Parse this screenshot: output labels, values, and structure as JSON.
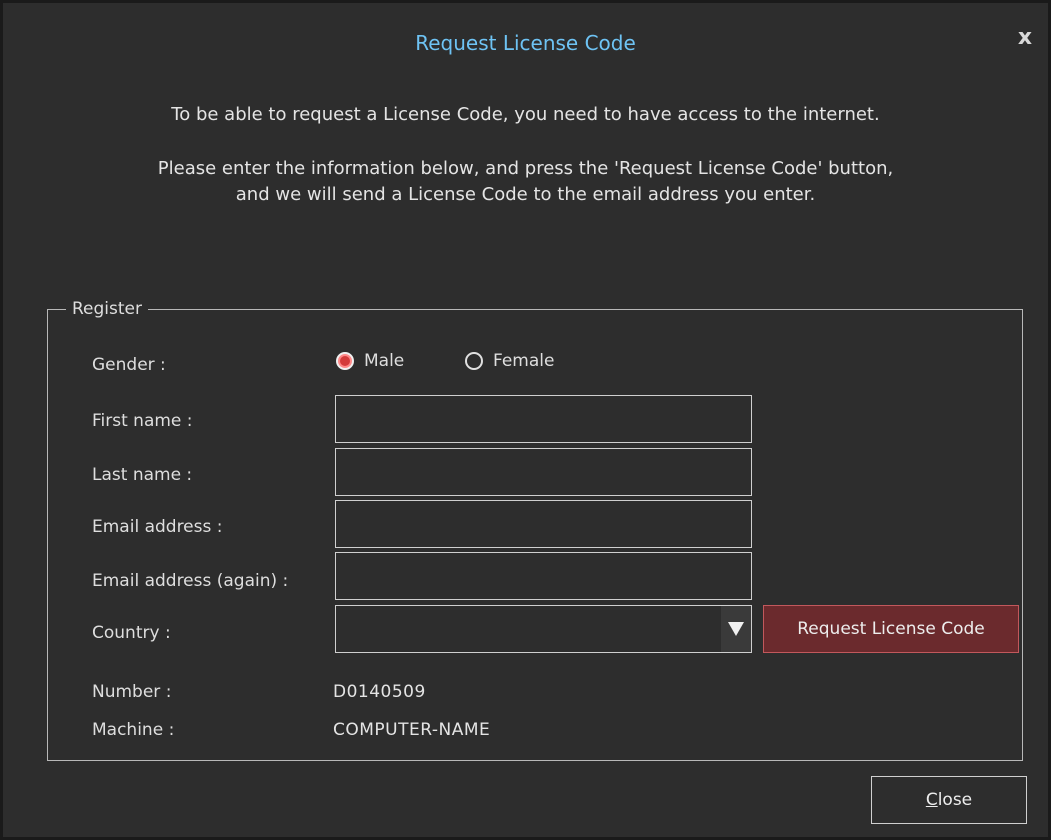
{
  "dialog": {
    "title": "Request License Code",
    "close_glyph": "x",
    "intro_line1": "To be able to request a License Code, you need to have access to the internet.",
    "intro_line2": "Please enter the information below, and press the 'Request License Code' button,",
    "intro_line3": "and we will send a License Code to the email address you enter.",
    "accent_color": "#6ec3f4"
  },
  "register": {
    "legend": "Register",
    "gender_label": "Gender :",
    "gender_options": [
      {
        "label": "Male",
        "selected": true
      },
      {
        "label": "Female",
        "selected": false
      }
    ],
    "first_name_label": "First name :",
    "first_name_value": "",
    "last_name_label": "Last name :",
    "last_name_value": "",
    "email_label": "Email address :",
    "email_value": "",
    "email_again_label": "Email address (again) :",
    "email_again_value": "",
    "country_label": "Country :",
    "country_value": "",
    "country_arrow_icon": "triangle-down-icon",
    "request_button_label": "Request License Code",
    "request_button_color": "#6b2a2d",
    "number_label": "Number :",
    "number_value": "D0140509",
    "machine_label": "Machine :",
    "machine_value": "COMPUTER-NAME"
  },
  "footer": {
    "close_button_mnemonic": "C",
    "close_button_rest": "lose"
  }
}
